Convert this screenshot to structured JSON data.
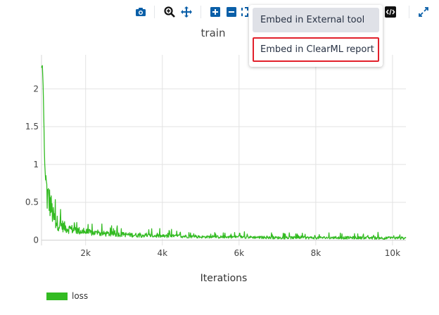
{
  "toolbar": {
    "icons": [
      "camera-icon",
      "zoom-icon",
      "pan-icon",
      "zoom-in-icon",
      "zoom-out-icon",
      "autoscale-icon",
      "embed-code-icon",
      "expand-icon"
    ],
    "icon_color": "#0a5fa8"
  },
  "menu": {
    "items": [
      {
        "label": "Embed in External tool"
      },
      {
        "label": "Embed in ClearML report"
      }
    ],
    "highlight_color": "#e2202b"
  },
  "chart_data": {
    "type": "line",
    "title": "train",
    "xlabel": "Iterations",
    "ylabel": "",
    "xlim": [
      850,
      10350
    ],
    "ylim": [
      -0.07,
      2.45
    ],
    "x_ticks": [
      2000,
      4000,
      6000,
      8000,
      10000
    ],
    "x_tick_labels": [
      "2k",
      "4k",
      "6k",
      "8k",
      "10k"
    ],
    "y_ticks": [
      0,
      0.5,
      1,
      1.5,
      2
    ],
    "y_tick_labels": [
      "0",
      "0.5",
      "1",
      "1.5",
      "2"
    ],
    "grid": true,
    "legend_position": "bottom-left",
    "series": [
      {
        "name": "loss",
        "color": "#33bb22",
        "x": [
          850,
          870,
          890,
          910,
          930,
          960,
          1000,
          1050,
          1100,
          1150,
          1200,
          1300,
          1400,
          1500,
          1600,
          1800,
          2000,
          2200,
          2500,
          3000,
          3500,
          4000,
          4500,
          5000,
          6000,
          7000,
          8000,
          9000,
          10000,
          10350
        ],
        "y": [
          2.28,
          2.32,
          2.1,
          1.6,
          1.05,
          0.75,
          0.55,
          0.5,
          0.42,
          0.3,
          0.25,
          0.2,
          0.18,
          0.15,
          0.14,
          0.12,
          0.1,
          0.09,
          0.08,
          0.07,
          0.06,
          0.05,
          0.05,
          0.04,
          0.04,
          0.03,
          0.03,
          0.03,
          0.025,
          0.025
        ]
      }
    ]
  }
}
